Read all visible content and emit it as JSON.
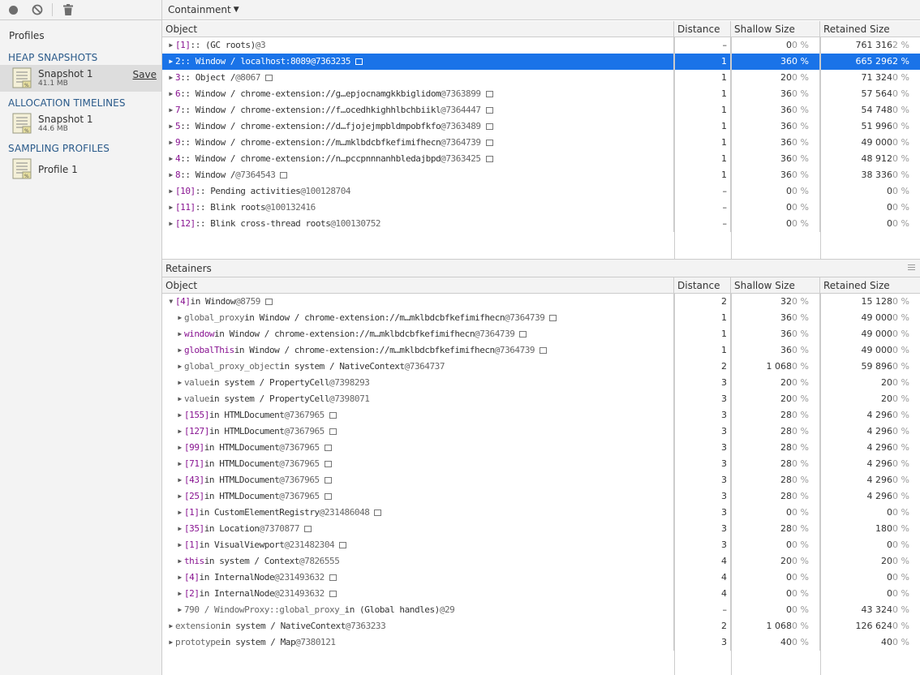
{
  "toolbar": {
    "record_icon": "record-icon",
    "clear_icon": "clear-icon",
    "delete_icon": "trash-icon"
  },
  "sidebar": {
    "title": "Profiles",
    "sections": [
      {
        "title": "HEAP SNAPSHOTS",
        "items": [
          {
            "name": "Snapshot 1",
            "size": "41.1 MB",
            "save": "Save",
            "selected": true
          }
        ]
      },
      {
        "title": "ALLOCATION TIMELINES",
        "items": [
          {
            "name": "Snapshot 1",
            "size": "44.6 MB"
          }
        ]
      },
      {
        "title": "SAMPLING PROFILES",
        "items": [
          {
            "name": "Profile 1",
            "size": ""
          }
        ]
      }
    ]
  },
  "view": {
    "selected": "Containment"
  },
  "columns": {
    "object": "Object",
    "distance": "Distance",
    "shallow": "Shallow Size",
    "retained": "Retained Size"
  },
  "retainers_title": "Retainers",
  "top_rows": [
    {
      "idx": "[1]",
      "text": " :: (GC roots) ",
      "id": "@3",
      "box": false,
      "distance": "–",
      "shallow": "0",
      "shallow_pct": "0 %",
      "retained": "761 316",
      "retained_pct": "2 %"
    },
    {
      "idx": "2",
      "text": " :: Window / localhost:8089 ",
      "id": "@7363235",
      "box": true,
      "selected": true,
      "distance": "1",
      "shallow": "36",
      "shallow_pct": "0 %",
      "retained": "665 296",
      "retained_pct": "2 %"
    },
    {
      "idx": "3",
      "text": " :: Object /  ",
      "id": "@8067",
      "box": true,
      "distance": "1",
      "shallow": "20",
      "shallow_pct": "0 %",
      "retained": "71 324",
      "retained_pct": "0 %"
    },
    {
      "idx": "6",
      "text": " :: Window / chrome-extension://g…epjocnamgkkbiglidom ",
      "id": "@7363899",
      "box": true,
      "distance": "1",
      "shallow": "36",
      "shallow_pct": "0 %",
      "retained": "57 564",
      "retained_pct": "0 %"
    },
    {
      "idx": "7",
      "text": " :: Window / chrome-extension://f…ocedhkighhlbchbiikl ",
      "id": "@7364447",
      "box": true,
      "distance": "1",
      "shallow": "36",
      "shallow_pct": "0 %",
      "retained": "54 748",
      "retained_pct": "0 %"
    },
    {
      "idx": "5",
      "text": " :: Window / chrome-extension://d…fjojejmpbldmpobfkfo ",
      "id": "@7363489",
      "box": true,
      "distance": "1",
      "shallow": "36",
      "shallow_pct": "0 %",
      "retained": "51 996",
      "retained_pct": "0 %"
    },
    {
      "idx": "9",
      "text": " :: Window / chrome-extension://m…mklbdcbfkefimifhecn ",
      "id": "@7364739",
      "box": true,
      "distance": "1",
      "shallow": "36",
      "shallow_pct": "0 %",
      "retained": "49 000",
      "retained_pct": "0 %"
    },
    {
      "idx": "4",
      "text": " :: Window / chrome-extension://n…pccpnnnanhbledajbpd ",
      "id": "@7363425",
      "box": true,
      "distance": "1",
      "shallow": "36",
      "shallow_pct": "0 %",
      "retained": "48 912",
      "retained_pct": "0 %"
    },
    {
      "idx": "8",
      "text": " :: Window /  ",
      "id": "@7364543",
      "box": true,
      "distance": "1",
      "shallow": "36",
      "shallow_pct": "0 %",
      "retained": "38 336",
      "retained_pct": "0 %"
    },
    {
      "idx": "[10]",
      "text": " :: Pending activities ",
      "id": "@100128704",
      "box": false,
      "distance": "–",
      "shallow": "0",
      "shallow_pct": "0 %",
      "retained": "0",
      "retained_pct": "0 %"
    },
    {
      "idx": "[11]",
      "text": " :: Blink roots ",
      "id": "@100132416",
      "box": false,
      "distance": "–",
      "shallow": "0",
      "shallow_pct": "0 %",
      "retained": "0",
      "retained_pct": "0 %"
    },
    {
      "idx": "[12]",
      "text": " :: Blink cross-thread roots ",
      "id": "@100130752",
      "box": false,
      "distance": "–",
      "shallow": "0",
      "shallow_pct": "0 %",
      "retained": "0",
      "retained_pct": "0 %"
    }
  ],
  "retainer_rows": [
    {
      "level": 0,
      "expanded": true,
      "idx": "[4]",
      "text": " in Window ",
      "id": "@8759",
      "box": true,
      "distance": "2",
      "shallow": "32",
      "shallow_pct": "0 %",
      "retained": "15 128",
      "retained_pct": "0 %"
    },
    {
      "level": 1,
      "name": "global_proxy",
      "name_style": "grey",
      "text": " in Window / chrome-extension://m…mklbdcbfkefimifhecn ",
      "id": "@7364739",
      "box": true,
      "distance": "1",
      "shallow": "36",
      "shallow_pct": "0 %",
      "retained": "49 000",
      "retained_pct": "0 %"
    },
    {
      "level": 1,
      "name": "window",
      "name_style": "kw",
      "text": " in Window / chrome-extension://m…mklbdcbfkefimifhecn ",
      "id": "@7364739",
      "box": true,
      "distance": "1",
      "shallow": "36",
      "shallow_pct": "0 %",
      "retained": "49 000",
      "retained_pct": "0 %"
    },
    {
      "level": 1,
      "name": "globalThis",
      "name_style": "kw",
      "text": " in Window / chrome-extension://m…mklbdcbfkefimifhecn ",
      "id": "@7364739",
      "box": true,
      "distance": "1",
      "shallow": "36",
      "shallow_pct": "0 %",
      "retained": "49 000",
      "retained_pct": "0 %"
    },
    {
      "level": 1,
      "name": "global_proxy_object",
      "name_style": "grey",
      "text": " in system / NativeContext ",
      "id": "@7364737",
      "box": false,
      "distance": "2",
      "shallow": "1 068",
      "shallow_pct": "0 %",
      "retained": "59 896",
      "retained_pct": "0 %"
    },
    {
      "level": 1,
      "name": "value",
      "name_style": "grey",
      "text": " in system / PropertyCell ",
      "id": "@7398293",
      "box": false,
      "distance": "3",
      "shallow": "20",
      "shallow_pct": "0 %",
      "retained": "20",
      "retained_pct": "0 %"
    },
    {
      "level": 1,
      "name": "value",
      "name_style": "grey",
      "text": " in system / PropertyCell ",
      "id": "@7398071",
      "box": false,
      "distance": "3",
      "shallow": "20",
      "shallow_pct": "0 %",
      "retained": "20",
      "retained_pct": "0 %"
    },
    {
      "level": 1,
      "idx": "[155]",
      "text": " in HTMLDocument ",
      "id": "@7367965",
      "box": true,
      "distance": "3",
      "shallow": "28",
      "shallow_pct": "0 %",
      "retained": "4 296",
      "retained_pct": "0 %"
    },
    {
      "level": 1,
      "idx": "[127]",
      "text": " in HTMLDocument ",
      "id": "@7367965",
      "box": true,
      "distance": "3",
      "shallow": "28",
      "shallow_pct": "0 %",
      "retained": "4 296",
      "retained_pct": "0 %"
    },
    {
      "level": 1,
      "idx": "[99]",
      "text": " in HTMLDocument ",
      "id": "@7367965",
      "box": true,
      "distance": "3",
      "shallow": "28",
      "shallow_pct": "0 %",
      "retained": "4 296",
      "retained_pct": "0 %"
    },
    {
      "level": 1,
      "idx": "[71]",
      "text": " in HTMLDocument ",
      "id": "@7367965",
      "box": true,
      "distance": "3",
      "shallow": "28",
      "shallow_pct": "0 %",
      "retained": "4 296",
      "retained_pct": "0 %"
    },
    {
      "level": 1,
      "idx": "[43]",
      "text": " in HTMLDocument ",
      "id": "@7367965",
      "box": true,
      "distance": "3",
      "shallow": "28",
      "shallow_pct": "0 %",
      "retained": "4 296",
      "retained_pct": "0 %"
    },
    {
      "level": 1,
      "idx": "[25]",
      "text": " in HTMLDocument ",
      "id": "@7367965",
      "box": true,
      "distance": "3",
      "shallow": "28",
      "shallow_pct": "0 %",
      "retained": "4 296",
      "retained_pct": "0 %"
    },
    {
      "level": 1,
      "idx": "[1]",
      "text": " in CustomElementRegistry ",
      "id": "@231486048",
      "box": true,
      "distance": "3",
      "shallow": "0",
      "shallow_pct": "0 %",
      "retained": "0",
      "retained_pct": "0 %"
    },
    {
      "level": 1,
      "idx": "[35]",
      "text": " in Location ",
      "id": "@7370877",
      "box": true,
      "distance": "3",
      "shallow": "28",
      "shallow_pct": "0 %",
      "retained": "180",
      "retained_pct": "0 %"
    },
    {
      "level": 1,
      "idx": "[1]",
      "text": " in VisualViewport ",
      "id": "@231482304",
      "box": true,
      "distance": "3",
      "shallow": "0",
      "shallow_pct": "0 %",
      "retained": "0",
      "retained_pct": "0 %"
    },
    {
      "level": 1,
      "name": "this",
      "name_style": "kw",
      "text": " in system / Context ",
      "id": "@7826555",
      "box": false,
      "distance": "4",
      "shallow": "20",
      "shallow_pct": "0 %",
      "retained": "20",
      "retained_pct": "0 %"
    },
    {
      "level": 1,
      "idx": "[4]",
      "text": " in InternalNode ",
      "id": "@231493632",
      "box": true,
      "distance": "4",
      "shallow": "0",
      "shallow_pct": "0 %",
      "retained": "0",
      "retained_pct": "0 %"
    },
    {
      "level": 1,
      "idx": "[2]",
      "text": " in InternalNode ",
      "id": "@231493632",
      "box": true,
      "distance": "4",
      "shallow": "0",
      "shallow_pct": "0 %",
      "retained": "0",
      "retained_pct": "0 %"
    },
    {
      "level": 1,
      "name": "790 / WindowProxy::global_proxy_",
      "name_style": "grey",
      "text": " in (Global handles) ",
      "id": "@29",
      "box": false,
      "distance": "–",
      "shallow": "0",
      "shallow_pct": "0 %",
      "retained": "43 324",
      "retained_pct": "0 %"
    },
    {
      "level": 0,
      "name": "extension",
      "name_style": "grey",
      "text": " in system / NativeContext ",
      "id": "@7363233",
      "box": false,
      "distance": "2",
      "shallow": "1 068",
      "shallow_pct": "0 %",
      "retained": "126 624",
      "retained_pct": "0 %"
    },
    {
      "level": 0,
      "name": "prototype",
      "name_style": "grey",
      "text": " in system / Map ",
      "id": "@7380121",
      "box": false,
      "distance": "3",
      "shallow": "40",
      "shallow_pct": "0 %",
      "retained": "40",
      "retained_pct": "0 %"
    }
  ]
}
